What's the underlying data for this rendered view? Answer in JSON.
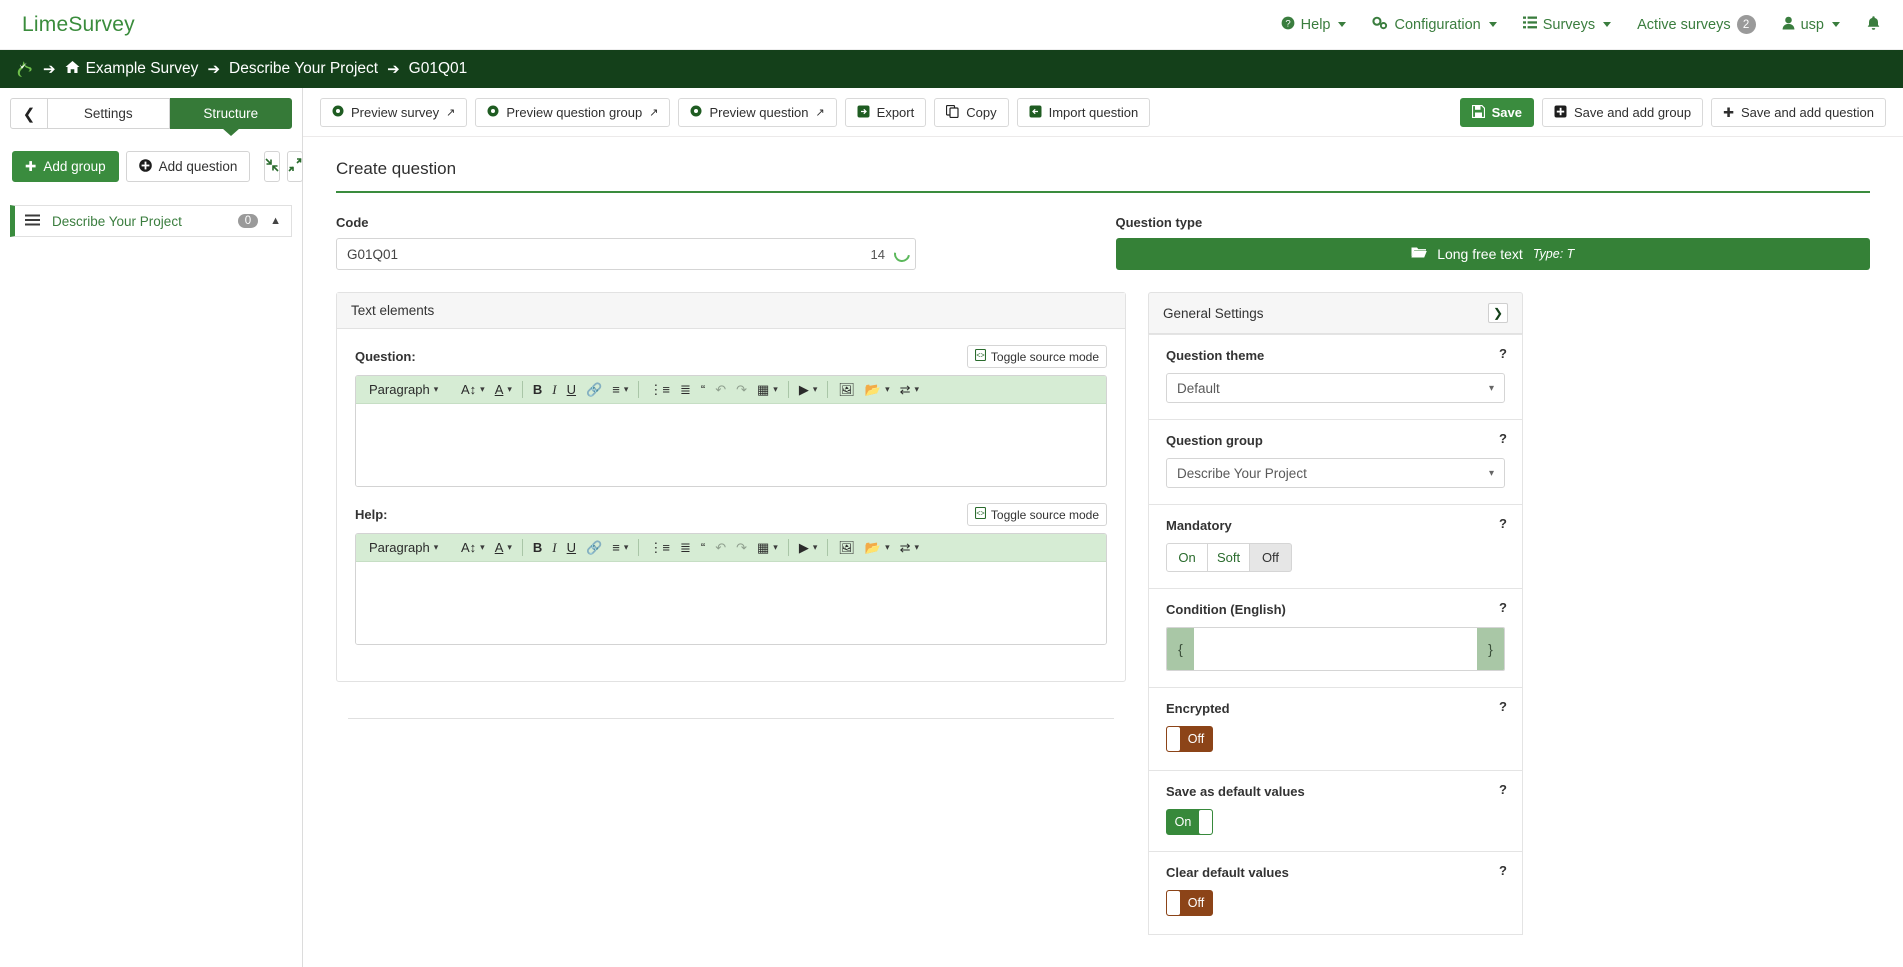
{
  "navbar": {
    "brand": "LimeSurvey",
    "items": [
      {
        "label": "Help",
        "icon": "help-circle-icon",
        "caret": true
      },
      {
        "label": "Configuration",
        "icon": "gears-icon",
        "caret": true
      },
      {
        "label": "Surveys",
        "icon": "list-icon",
        "caret": true
      },
      {
        "label": "Active surveys",
        "icon": "",
        "badge": "2"
      },
      {
        "label": "usp",
        "icon": "user-icon",
        "caret": true
      },
      {
        "label": "",
        "icon": "bell-icon"
      }
    ]
  },
  "breadcrumb": {
    "logo": "limesurvey-logo-icon",
    "arrow": "➔",
    "items": [
      {
        "label": "Example Survey",
        "icon": "home-icon"
      },
      {
        "label": "Describe Your Project",
        "icon": ""
      },
      {
        "label": "G01Q01",
        "icon": ""
      }
    ]
  },
  "sidebar": {
    "back_icon": "chevron-left-icon",
    "tabs": [
      {
        "label": "Settings",
        "active": false
      },
      {
        "label": "Structure",
        "active": true
      }
    ],
    "actions": [
      {
        "label": "Add group",
        "icon": "plus-icon",
        "primary": true
      },
      {
        "label": "Add question",
        "icon": "plus-circle-icon",
        "primary": false
      }
    ],
    "icon_buttons": [
      {
        "icon": "collapse-all-icon"
      },
      {
        "icon": "expand-all-icon"
      }
    ],
    "groups": [
      {
        "name": "Describe Your Project",
        "count": "0",
        "grip": "grip-icon",
        "caret": "chevron-up-icon"
      }
    ]
  },
  "toolbar": {
    "left_buttons": [
      {
        "label": "Preview survey",
        "icon": "gear-icon",
        "external": true
      },
      {
        "label": "Preview question group",
        "icon": "gear-icon",
        "external": true
      },
      {
        "label": "Preview question",
        "icon": "gear-icon",
        "external": true
      },
      {
        "label": "Export",
        "icon": "export-icon",
        "external": false
      },
      {
        "label": "Copy",
        "icon": "copy-icon",
        "external": false
      },
      {
        "label": "Import question",
        "icon": "import-icon",
        "external": false
      }
    ],
    "right_buttons": [
      {
        "label": "Save",
        "icon": "floppy-icon",
        "primary": true
      },
      {
        "label": "Save and add group",
        "icon": "plus-square-icon",
        "primary": false
      },
      {
        "label": "Save and add question",
        "icon": "plus-icon",
        "primary": false
      }
    ]
  },
  "main": {
    "page_title": "Create question",
    "code": {
      "label": "Code",
      "value": "G01Q01",
      "placeholder": "",
      "counter": "14"
    },
    "question_type": {
      "label": "Question type",
      "icon": "folder-open-icon",
      "value": "Long free text",
      "type_suffix": "Type: T"
    },
    "text_elements": {
      "panel_title": "Text elements",
      "question": {
        "label": "Question:",
        "toggle_source_label": "Toggle source mode",
        "toggle_source_icon": "source-code-icon",
        "content": ""
      },
      "help": {
        "label": "Help:",
        "toggle_source_label": "Toggle source mode",
        "toggle_source_icon": "source-code-icon",
        "content": ""
      },
      "editor_toolbar": {
        "paragraph_label": "Paragraph",
        "buttons": [
          {
            "name": "font-size-icon",
            "glyph": "A↕",
            "caret": true
          },
          {
            "name": "font-color-icon",
            "glyph": "A",
            "caret": true
          },
          {
            "name": "bold-icon",
            "glyph": "B",
            "caret": false
          },
          {
            "name": "italic-icon",
            "glyph": "I",
            "caret": false
          },
          {
            "name": "underline-icon",
            "glyph": "U",
            "caret": false
          },
          {
            "name": "link-icon",
            "glyph": "🔗",
            "caret": false
          },
          {
            "name": "align-icon",
            "glyph": "≡",
            "caret": true
          },
          {
            "name": "bullet-list-icon",
            "glyph": "•≡",
            "caret": false
          },
          {
            "name": "numbered-list-icon",
            "glyph": "1≡",
            "caret": false
          },
          {
            "name": "blockquote-icon",
            "glyph": "“",
            "caret": false
          },
          {
            "name": "undo-icon",
            "glyph": "↶",
            "caret": false
          },
          {
            "name": "redo-icon",
            "glyph": "↷",
            "caret": false
          },
          {
            "name": "table-icon",
            "glyph": "▦",
            "caret": true
          },
          {
            "name": "media-icon",
            "glyph": "▶",
            "caret": true
          },
          {
            "name": "image-icon",
            "glyph": "⛰",
            "caret": false
          },
          {
            "name": "file-manager-icon",
            "glyph": "🗀",
            "caret": true
          },
          {
            "name": "ltr-rtl-icon",
            "glyph": "⇆",
            "caret": true
          }
        ]
      }
    }
  },
  "general_settings": {
    "panel_title": "General Settings",
    "collapse_icon": "chevron-right-icon",
    "items": [
      {
        "title": "Question theme",
        "control": "select",
        "value": "Default",
        "help": "?"
      },
      {
        "title": "Question group",
        "control": "select",
        "value": "Describe Your Project",
        "help": "?"
      },
      {
        "title": "Mandatory",
        "control": "buttongroup",
        "options": [
          "On",
          "Soft",
          "Off"
        ],
        "selected": "Off",
        "help": "?"
      },
      {
        "title": "Condition (English)",
        "control": "condition",
        "brace_left": "{",
        "brace_right": "}",
        "value": "",
        "help": "?"
      },
      {
        "title": "Encrypted",
        "control": "switch",
        "state": "Off",
        "help": "?"
      },
      {
        "title": "Save as default values",
        "control": "switch",
        "state": "On",
        "help": "?"
      },
      {
        "title": "Clear default values",
        "control": "switch",
        "state": "Off",
        "help": "?"
      }
    ]
  },
  "colors": {
    "brand_green": "#3a8c3e",
    "dark_green": "#14401a",
    "editor_toolbar_bg": "#d6ecd4",
    "switch_off": "#8c4418",
    "switch_on": "#37893b"
  }
}
